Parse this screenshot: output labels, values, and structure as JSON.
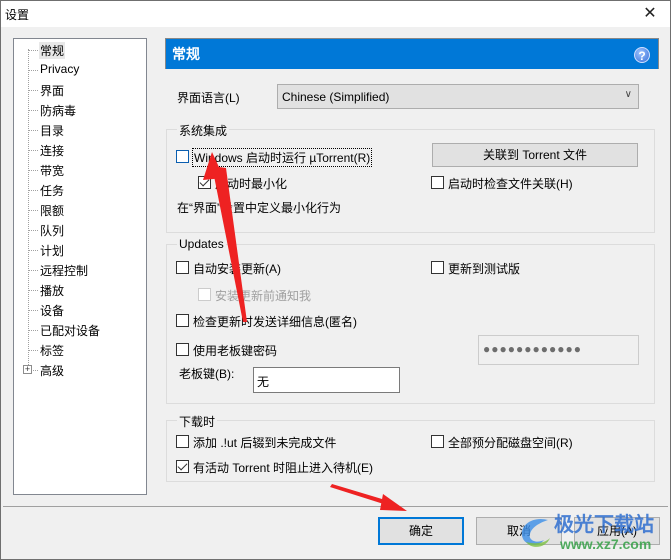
{
  "window": {
    "title": "设置",
    "close_icon": "close-icon"
  },
  "sidebar": {
    "items": [
      {
        "label": "常规",
        "selected": true
      },
      {
        "label": "Privacy"
      },
      {
        "label": "界面"
      },
      {
        "label": "防病毒"
      },
      {
        "label": "目录"
      },
      {
        "label": "连接"
      },
      {
        "label": "带宽"
      },
      {
        "label": "任务"
      },
      {
        "label": "限额"
      },
      {
        "label": "队列"
      },
      {
        "label": "计划"
      },
      {
        "label": "远程控制"
      },
      {
        "label": "播放"
      },
      {
        "label": "设备"
      },
      {
        "label": "已配对设备"
      },
      {
        "label": "标签"
      },
      {
        "label": "高级",
        "expandable": true,
        "expander": "+"
      }
    ]
  },
  "header": {
    "title": "常规",
    "help": "?",
    "accent_color": "#0078d7"
  },
  "language": {
    "label": "界面语言(L)",
    "value": "Chinese (Simplified)",
    "dropdown_icon": "chevron-down-icon"
  },
  "system_integration": {
    "title": "系统集成",
    "run_on_startup": {
      "label": "Windows 启动时运行 µTorrent(R)",
      "checked": false
    },
    "start_minimized": {
      "label": "启动时最小化",
      "checked": true
    },
    "associate_button": "关联到 Torrent 文件",
    "check_association": {
      "label": "启动时检查文件关联(H)",
      "checked": false
    },
    "hint": "在“界面”设置中定义最小化行为"
  },
  "updates": {
    "title": "Updates",
    "auto_install": {
      "label": "自动安装更新(A)",
      "checked": false
    },
    "update_to_beta": {
      "label": "更新到测试版",
      "checked": false
    },
    "notify_before_install": {
      "label": "安装更新前通知我",
      "checked": false,
      "disabled": true
    },
    "send_info": {
      "label": "检查更新时发送详细信息(匿名)",
      "checked": false
    },
    "boss_key_password": {
      "label": "使用老板键密码",
      "checked": false
    },
    "password_value": "●●●●●●●●●●●●",
    "boss_key_label": "老板键(B):",
    "boss_key_value": "无"
  },
  "while_downloading": {
    "title": "下载时",
    "append_ut": {
      "label": "添加 .!ut 后辍到未完成文件",
      "checked": false
    },
    "preallocate": {
      "label": "全部预分配磁盘空间(R)",
      "checked": false
    },
    "prevent_standby": {
      "label": "有活动 Torrent 时阻止进入待机(E)",
      "checked": true
    }
  },
  "footer": {
    "ok": "确定",
    "cancel": "取消",
    "apply": "应用(A)"
  },
  "watermark": {
    "title": "极光下载站",
    "url": "www.xz7.com"
  }
}
